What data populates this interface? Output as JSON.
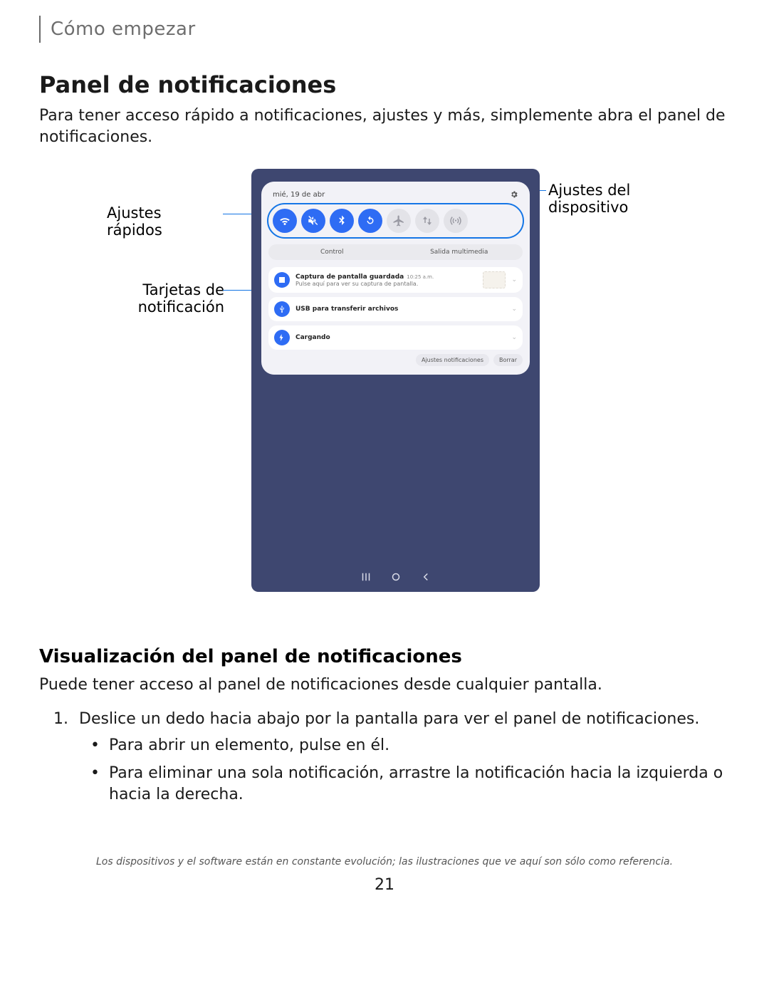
{
  "header": {
    "section": "Cómo empezar"
  },
  "title": "Panel de notificaciones",
  "intro": "Para tener acceso rápido a notificaciones, ajustes y más, simplemente abra el panel de notificaciones.",
  "callouts": {
    "quick_settings": "Ajustes rápidos",
    "notif_cards": "Tarjetas de notificación",
    "device_settings": "Ajustes del dispositivo"
  },
  "phone": {
    "date": "mié, 19 de abr",
    "settings_icon": "gear",
    "quick_settings": [
      {
        "name": "wifi",
        "active": true
      },
      {
        "name": "mute",
        "active": true
      },
      {
        "name": "bluetooth",
        "active": true
      },
      {
        "name": "rotate",
        "active": true
      },
      {
        "name": "airplane",
        "active": false
      },
      {
        "name": "data",
        "active": false
      },
      {
        "name": "hotspot",
        "active": false
      }
    ],
    "pill_tabs": {
      "left": "Control",
      "right": "Salida multimedia"
    },
    "notifications": [
      {
        "icon": "image",
        "title": "Captura de pantalla guardada",
        "time": "10:25 a.m.",
        "subtitle": "Pulse aquí para ver su captura de pantalla.",
        "has_thumb": true
      },
      {
        "icon": "usb",
        "title": "USB para transferir archivos",
        "time": "",
        "subtitle": "",
        "has_thumb": false
      },
      {
        "icon": "bolt",
        "title": "Cargando",
        "time": "",
        "subtitle": "",
        "has_thumb": false
      }
    ],
    "footer_buttons": {
      "settings": "Ajustes notificaciones",
      "clear": "Borrar"
    }
  },
  "subtitle": "Visualización del panel de notificaciones",
  "sub_intro": "Puede tener acceso al panel de notificaciones desde cualquier pantalla.",
  "step1": "Deslice un dedo hacia abajo por la pantalla para ver el panel de notificaciones.",
  "bullet1": "Para abrir un elemento, pulse en él.",
  "bullet2": "Para eliminar una sola notificación, arrastre la notificación hacia la izquierda o hacia la derecha.",
  "footnote": "Los dispositivos y el software están en constante evolución; las ilustraciones que ve aquí son sólo como referencia.",
  "page_number": "21"
}
